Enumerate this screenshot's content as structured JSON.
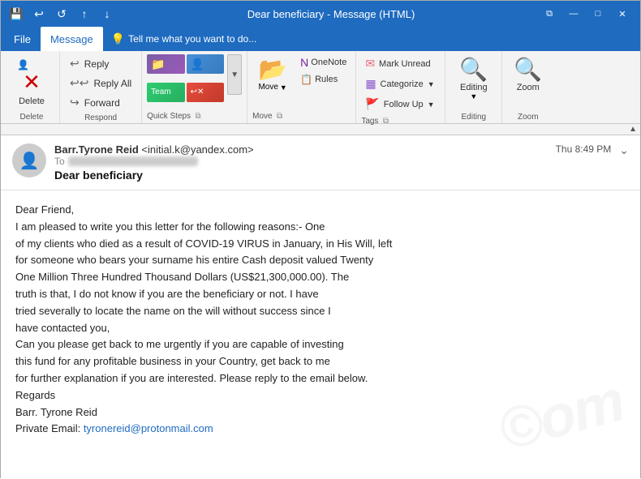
{
  "titlebar": {
    "title": "Dear beneficiary - Message (HTML)",
    "save_icon": "💾",
    "undo_icon": "↩",
    "redo_icon": "↺",
    "up_icon": "↑",
    "down_icon": "↓",
    "restore_icon": "⧉",
    "minimize_icon": "—",
    "maximize_icon": "□",
    "close_icon": "✕"
  },
  "menubar": {
    "items": [
      {
        "label": "File",
        "active": false
      },
      {
        "label": "Message",
        "active": true
      },
      {
        "label": "Tell me what you want to do...",
        "is_tellme": true
      }
    ]
  },
  "ribbon": {
    "delete_group": {
      "label": "Delete",
      "delete_btn": "Delete"
    },
    "respond_group": {
      "label": "Respond",
      "reply_label": "Reply",
      "reply_all_label": "Reply All",
      "forward_label": "Forward"
    },
    "quicksteps_group": {
      "label": "Quick Steps",
      "items": [
        "Move to: ?",
        "To Manager",
        "Team Email",
        "Reply & Delete"
      ]
    },
    "move_group": {
      "label": "Move",
      "move_label": "Move",
      "rules_label": "Rules",
      "onenote_label": "OneNote"
    },
    "tags_group": {
      "label": "Tags",
      "mark_unread": "Mark Unread",
      "categorize": "Categorize",
      "follow_up": "Follow Up"
    },
    "editing_group": {
      "label": "Editing",
      "editing_label": "Editing"
    },
    "zoom_group": {
      "label": "Zoom",
      "zoom_label": "Zoom"
    }
  },
  "email": {
    "from_name": "Barr.Tyrone Reid",
    "from_email": "<initial.k@yandex.com>",
    "subject": "Dear beneficiary",
    "date": "Thu 8:49 PM",
    "body_lines": [
      "Dear Friend,",
      "I am pleased to write you this letter for the following reasons:- One",
      "of my clients who died as a result of COVID-19 VIRUS in January, in His Will, left",
      "for someone who bears your surname his entire Cash deposit valued Twenty",
      "One Million Three Hundred Thousand Dollars (US$21,300,000.00). The",
      "truth is that, I do not know if you are the beneficiary or not. I have",
      "tried severally to locate the name on the will without success since I",
      "have contacted you,",
      "Can you please get back to me urgently if you are capable of investing",
      "this fund for any profitable business in your Country, get back to me",
      "for further explanation if you are interested. Please reply to the email below.",
      "Regards",
      "Barr. Tyrone Reid",
      "Private Email: tyronereid@protonmail.com"
    ],
    "email_link": "tyronereid@protonmail.com",
    "watermark": "©om"
  }
}
